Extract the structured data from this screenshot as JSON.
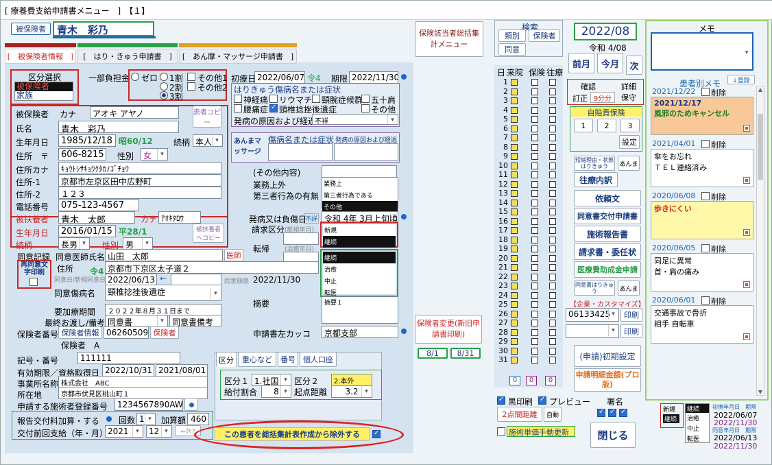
{
  "window": {
    "title": "[ 療養費支給申請書メニュー　]　【１】"
  },
  "patient": {
    "label": "被保険者",
    "name": "青木　彩乃"
  },
  "tabs": [
    {
      "label": "[　被保険者情報　]"
    },
    {
      "label": "[　はり・きゅう申請書　]"
    },
    {
      "label": "[　あん摩・マッサージ申請書　]"
    }
  ],
  "kubun": {
    "title": "区分選択",
    "options": [
      "被保険者",
      "家族"
    ],
    "selected": "被保険者"
  },
  "futan": {
    "label": "一部負担金",
    "zero": "ゼロ",
    "w1": "1割",
    "w2": "2割",
    "w3": "3割",
    "other1": "その他1",
    "other2": "その他2"
  },
  "shoryo": {
    "label": "初療日",
    "value": "2022/06/07",
    "rei": "令4",
    "kikan_label": "期限",
    "kikan": "2022/11/30"
  },
  "harikyu": {
    "title": "はりきゅう傷病名または症状",
    "items": [
      "神経痛",
      "リウマチ",
      "頸腕症候群",
      "五十肩",
      "腰痛症",
      "頸椎捻挫後遺症",
      "その他"
    ],
    "cause_label": "発病の原因および経過",
    "cause_value": "不祥"
  },
  "amma": {
    "title": "あんまマッサージ",
    "col1": "傷病名または症状",
    "col2": "発病の原因および経過"
  },
  "insured": {
    "label": "被保険者",
    "kana_label": "カナ",
    "kana": "アオキ アヤノ",
    "name_label": "氏名",
    "name": "青木　彩乃",
    "birth_label": "生年月日",
    "birth": "1985/12/18",
    "birth_era": "昭60/12",
    "zokugara_label": "続柄",
    "zokugara": "本人",
    "addr_label": "住所　〒",
    "zip": "606-8215",
    "sex_label": "性別",
    "sex": "女",
    "addr_kana_label": "住所カナ",
    "addr_kana": "ｷｮｳﾄｼｻｷｮｳｸﾀｶﾉｺﾞﾁｮｳ",
    "addr1_label": "住所-1",
    "addr1": "京都市左京区田中広野町",
    "addr2_label": "住所-2",
    "addr2": "１２３",
    "tel_label": "電話番号",
    "tel": "075-123-4567",
    "copy_btn": "患者コピー"
  },
  "fuyo": {
    "name_label": "被扶養者",
    "name": "青木　太郎",
    "kana_label": "カナ",
    "kana": "ｱｵｷﾀﾛｳ",
    "birth_label": "生年月日",
    "birth": "2016/01/15",
    "birth_era": "平28/1",
    "zokugara_label": "続柄",
    "zokugara": "長男",
    "sex_label": "性別",
    "sex": "男",
    "copy_btn": "被扶養者へコピー"
  },
  "other": {
    "title": "(その他内容)",
    "gyomu_label": "業務上外",
    "daisan_label": "第三者行為の有無",
    "list": [
      "業務上",
      "第三者行為である",
      "その他"
    ],
    "hatsubyo_label": "発病又は負傷日",
    "fusho": "不詳",
    "hatsubyo_value": "令和 4年 3月上旬頃",
    "seikyu_label": "請求区分",
    "seikyu_sub": "(新規年月)",
    "seikyu_list": [
      "新規",
      "継続"
    ],
    "tenki_label": "転帰",
    "tenki_sub": "(治癒年月)",
    "tenki_list": [
      "継続",
      "治癒",
      "中止",
      "転医"
    ],
    "tekiyo_label": "摘要",
    "tekiyo_value": "摘要１",
    "kakko_label": "申請書左カッコ",
    "kakko_value": "京都支部"
  },
  "doui": {
    "record_label": "同意記録",
    "doctor_label": "同意医師氏名",
    "doctor": "山田　太郎",
    "ishi_btn": "医師",
    "saidoui": "再同意文字印刷",
    "addr_label": "住所",
    "rei4": "令4",
    "addr": "京都市下京区太子道２",
    "date_label": "同意日/新規同意日",
    "date": "2022/06/13",
    "kigen_label": "同意期限",
    "kigen": "2022/11/30",
    "byomei_label": "同意傷病名",
    "byomei": "頸椎捻挫後遺症",
    "yokaigo_label": "要加療期間",
    "yokaigo": "２０２２年８月３１日まで",
    "saishu_label": "最終お渡し/備考",
    "saishu1": "同意書",
    "saishu2": "同意書備考"
  },
  "hoken": {
    "no_label": "保険者番号",
    "info_btn": "保険者情報",
    "no": "06260509",
    "btn": "保険者",
    "type_label": "保険者　A",
    "kigo_label": "記号・番号",
    "kigo": "111111",
    "yuko_label": "有効期限／資格取得日",
    "yuko": "2022/10/31",
    "shutoku": "2021/08/01",
    "jigyo_label": "事業所名称",
    "jigyo": "株式会社　ABC",
    "shozai_label": "所在地",
    "shozai": "京都市伏見区桃山町１",
    "shisetsu_label": "申請する施術者登録番号",
    "shisetsu": "1234567890AW"
  },
  "hokoku": {
    "label": "報告交付料加算・する",
    "kaisu_label": "回数",
    "kaisu": "1",
    "kasan_label": "加算額",
    "kasan": "460",
    "zenkai_label": "交付前回支給（年・月）",
    "year": "2021",
    "month": "12",
    "clear": "←ｸﾘｱ"
  },
  "kubun_tabs": [
    "区分",
    "重心など",
    "番号",
    "個人口座"
  ],
  "kubun_detail": {
    "k1_label": "区分１",
    "k1": "1.社国",
    "k2_label": "区分２",
    "k2": "2.本外",
    "kyufu_label": "給付割合",
    "kyufu": "8",
    "kiten_label": "起点距離",
    "kiten": "3.2"
  },
  "exclude_btn": "この患者を総括集計表作成から除外する",
  "side": {
    "sokatsu": "保険該当者総括集計メニュー",
    "search_title": "検索",
    "ruibetsu": "類別",
    "hokensha": "保険者",
    "doui": "同意",
    "henkou": "保険者変更(新旧申請書印刷)",
    "d1": "8/1",
    "d2": "8/31"
  },
  "month": {
    "value": "2022/08",
    "era": "令和 4/08",
    "prev": "前月",
    "this": "今月",
    "next": "次"
  },
  "kakunin": {
    "kakunin": "確認",
    "teisei": "訂正",
    "days": "9分分",
    "shosai": "詳細",
    "hozon": "保守"
  },
  "jibai": {
    "title": "自賠責保険",
    "b1": "1",
    "b2": "2",
    "b3": "3",
    "settei": "設定"
  },
  "small": {
    "riyu": "短縮理由・状態はりきゅう",
    "amma": "あんま",
    "ouryo": "往療内訳",
    "irai": "依頼文",
    "doui_kofu": "同意書交付申請書",
    "shijutsu": "施術報告書",
    "seikyu": "請求書・委任状",
    "iryohi": "医療費助成金申請",
    "dou2": "同意書はりきゅう",
    "amma2": "あんま"
  },
  "kigyo": {
    "title": "【企業・カスタマイズ】",
    "code": "06133425",
    "print1": "印刷",
    "print2": "印刷"
  },
  "initial": {
    "label": "(申請)初期設定",
    "meisai": "申請明細金額(プロ版)"
  },
  "days_header": {
    "hi": "日",
    "raiin": "来院",
    "hoken": "保険",
    "ouryo": "往療"
  },
  "days": [
    "1",
    "2",
    "3",
    "4",
    "5",
    "6",
    "7",
    "8",
    "9",
    "10",
    "11",
    "12",
    "13",
    "14",
    "15",
    "16",
    "17",
    "18",
    "19",
    "20",
    "21",
    "22",
    "23",
    "24",
    "25",
    "26",
    "27",
    "28",
    "29",
    "30",
    "31"
  ],
  "totals": [
    "0",
    "0",
    "0"
  ],
  "print_opts": {
    "kuro": "黒印刷",
    "preview": "プレビュー",
    "shomei": "署名",
    "kyori": "2点間距離",
    "jidou": "自動",
    "tanka": "施術単価手動更新",
    "close": "閉じる"
  },
  "bottom_info": {
    "shinki": "新規",
    "keizoku": "継続",
    "list": [
      "継続",
      "治癒",
      "中止",
      "転医"
    ],
    "shoryo_label": "初療年月日　期限",
    "shoryo": "2022/06/07",
    "kigen": "2022/11/30",
    "doui_label": "同意年月日　期限",
    "doui": "2022/06/13",
    "doui_kigen": "2022/11/30"
  },
  "memo": {
    "title": "メモ",
    "patient_memo": "患者別メモ",
    "register": "↓登録",
    "delete_label": "削除",
    "cards": [
      {
        "date": "2021/12/22",
        "lines": [
          "2021/12/17",
          "風邪のためキャンセル"
        ]
      },
      {
        "date": "2021/04/01",
        "lines": [
          "傘をお忘れ",
          "ＴＥＬ連絡済み"
        ]
      },
      {
        "date": "2020/06/08",
        "lines": [
          "歩きにくい"
        ]
      },
      {
        "date": "2020/06/05",
        "lines": [
          "同足に異常",
          "首・肩の痛み"
        ]
      },
      {
        "date": "2020/06/01",
        "lines": [
          "交通事故で骨折",
          "相手 自転車"
        ]
      }
    ]
  },
  "colors": {
    "red": "#c82828",
    "green": "#28a048",
    "blue_header": "#1a66b0",
    "yellow": "#fff066",
    "memo_orange": "#f8c898",
    "memo_yellow": "#fff8a8"
  }
}
